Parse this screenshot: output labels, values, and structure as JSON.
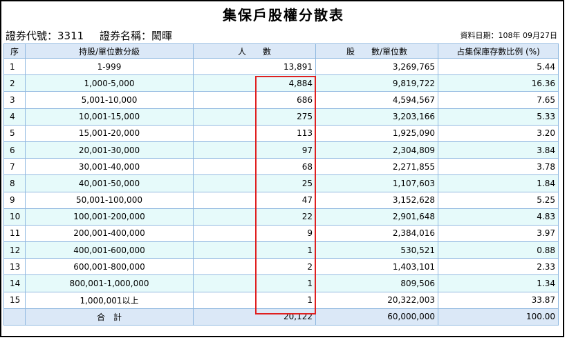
{
  "title": "集保戶股權分散表",
  "meta": {
    "stock_code_label": "證券代號：3311",
    "stock_name_label": "證券名稱：閎暉",
    "data_date": "資料日期：108年 09月27日"
  },
  "table": {
    "headers": [
      "序",
      "持股/單位數分級",
      "人　　數",
      "股　　數/單位數",
      "占集保庫存數比例 (%)"
    ],
    "rows": [
      [
        "1",
        "1-999",
        "13,891",
        "3,269,765",
        "5.44"
      ],
      [
        "2",
        "1,000-5,000",
        "4,884",
        "9,819,722",
        "16.36"
      ],
      [
        "3",
        "5,001-10,000",
        "686",
        "4,594,567",
        "7.65"
      ],
      [
        "4",
        "10,001-15,000",
        "275",
        "3,203,166",
        "5.33"
      ],
      [
        "5",
        "15,001-20,000",
        "113",
        "1,925,090",
        "3.20"
      ],
      [
        "6",
        "20,001-30,000",
        "97",
        "2,304,809",
        "3.84"
      ],
      [
        "7",
        "30,001-40,000",
        "68",
        "2,271,855",
        "3.78"
      ],
      [
        "8",
        "40,001-50,000",
        "25",
        "1,107,603",
        "1.84"
      ],
      [
        "9",
        "50,001-100,000",
        "47",
        "3,152,628",
        "5.25"
      ],
      [
        "10",
        "100,001-200,000",
        "22",
        "2,901,648",
        "4.83"
      ],
      [
        "11",
        "200,001-400,000",
        "9",
        "2,384,016",
        "3.97"
      ],
      [
        "12",
        "400,001-600,000",
        "1",
        "530,521",
        "0.88"
      ],
      [
        "13",
        "600,001-800,000",
        "2",
        "1,403,101",
        "2.33"
      ],
      [
        "14",
        "800,001-1,000,000",
        "1",
        "809,506",
        "1.34"
      ],
      [
        "15",
        "1,000,001以上",
        "1",
        "20,322,003",
        "33.87"
      ]
    ],
    "total": {
      "label": "合　計",
      "holders": "20,122",
      "shares": "60,000,000",
      "ratio": "100.00"
    }
  },
  "highlight_color": "#e02020"
}
